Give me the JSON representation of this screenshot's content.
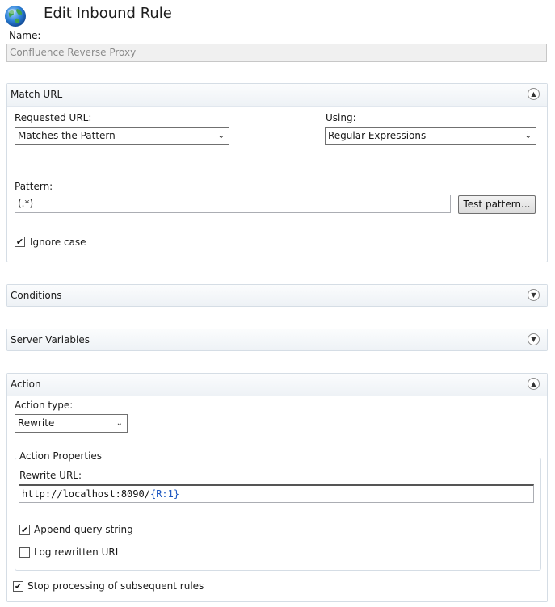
{
  "page": {
    "title": "Edit Inbound Rule",
    "icon": "globe-icon",
    "name_label": "Name:",
    "name_value": "Confluence Reverse Proxy"
  },
  "match_url": {
    "title": "Match URL",
    "expanded": true,
    "requested_url_label": "Requested URL:",
    "requested_url_value": "Matches the Pattern",
    "using_label": "Using:",
    "using_value": "Regular Expressions",
    "pattern_label": "Pattern:",
    "pattern_value": "(.*)",
    "test_pattern_button": "Test pattern...",
    "ignore_case_label": "Ignore case",
    "ignore_case_checked": true
  },
  "conditions": {
    "title": "Conditions",
    "expanded": false
  },
  "server_variables": {
    "title": "Server Variables",
    "expanded": false
  },
  "action": {
    "title": "Action",
    "expanded": true,
    "action_type_label": "Action type:",
    "action_type_value": "Rewrite",
    "properties_legend": "Action Properties",
    "rewrite_url_label": "Rewrite URL:",
    "rewrite_url_plain": "http://localhost:8090/",
    "rewrite_url_open_brace": "{",
    "rewrite_url_var": "R:1",
    "rewrite_url_close_brace": "}",
    "append_query_label": "Append query string",
    "append_query_checked": true,
    "log_rewritten_label": "Log rewritten URL",
    "log_rewritten_checked": false,
    "stop_processing_label": "Stop processing of subsequent rules",
    "stop_processing_checked": true
  },
  "colors": {
    "brace": "#1a55c0",
    "var": "#1a1a1a",
    "panel_border": "#d5dde5"
  }
}
